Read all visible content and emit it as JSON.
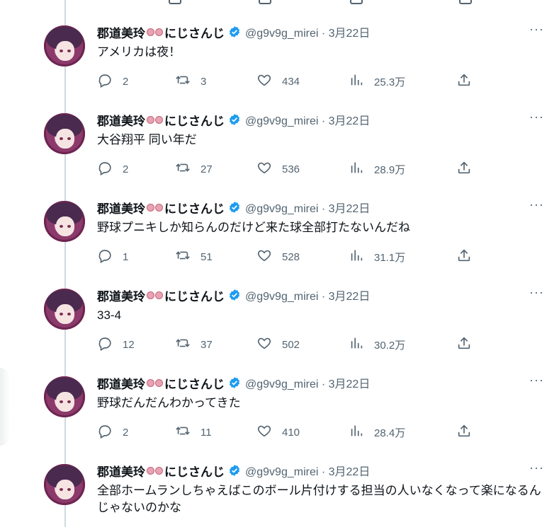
{
  "account": {
    "display_name_prefix": "郡道美玲",
    "display_name_suffix": "にじさんじ",
    "handle_date": "@g9v9g_mirei · 3月22日"
  },
  "icons": {
    "reply": "reply-icon",
    "retweet": "retweet-icon",
    "like": "heart-icon",
    "views": "views-icon",
    "share": "share-icon",
    "more": "more-icon",
    "verified": "verified-badge-icon"
  },
  "colors": {
    "verified": "#1d9bf0",
    "muted": "#536471",
    "text": "#0f1419",
    "thread_line": "#cfd9de"
  },
  "more_label": "···",
  "tweets": [
    {
      "text": "アメリカは夜！",
      "replies": "2",
      "retweets": "3",
      "likes": "434",
      "views": "25.3万"
    },
    {
      "text": "大谷翔平 同い年だ",
      "replies": "2",
      "retweets": "27",
      "likes": "536",
      "views": "28.9万"
    },
    {
      "text": "野球プニキしか知らんのだけど来た球全部打たないんだね",
      "replies": "1",
      "retweets": "51",
      "likes": "528",
      "views": "31.1万"
    },
    {
      "text": "33-4",
      "replies": "12",
      "retweets": "37",
      "likes": "502",
      "views": "30.2万"
    },
    {
      "text": "野球だんだんわかってきた",
      "replies": "2",
      "retweets": "11",
      "likes": "410",
      "views": "28.4万"
    },
    {
      "text": "全部ホームランしちゃえばこのボール片付けする担当の人いなくなって楽になるんじゃないのかな",
      "replies": "",
      "retweets": "",
      "likes": "",
      "views": ""
    }
  ]
}
